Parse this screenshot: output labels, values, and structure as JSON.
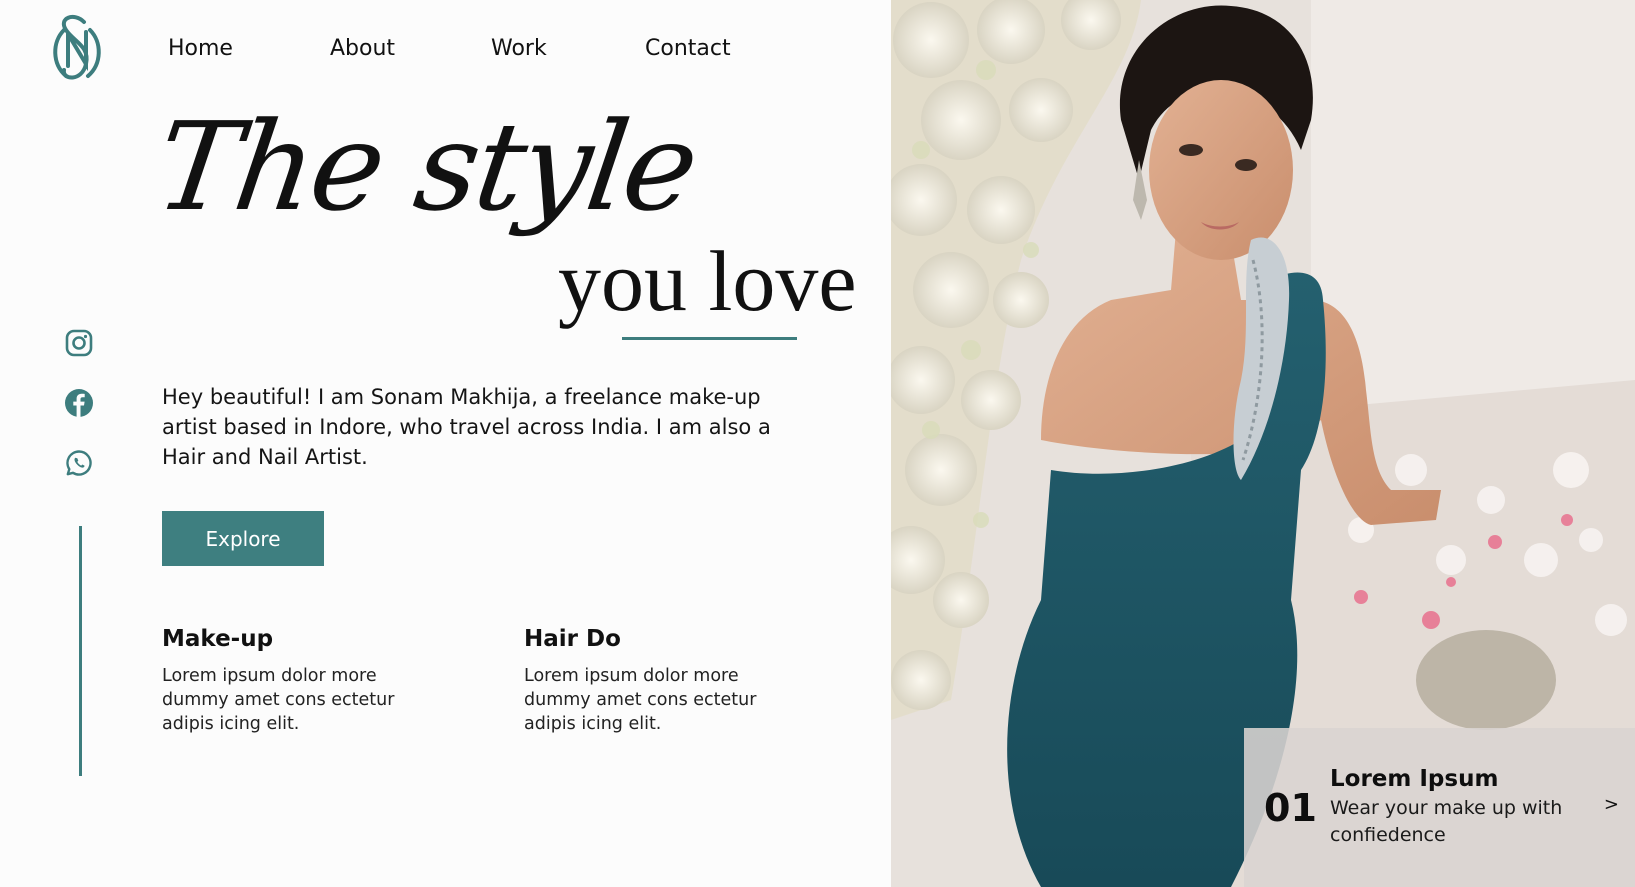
{
  "brand": {
    "logo_letters": "SM"
  },
  "nav": {
    "items": [
      "Home",
      "About",
      "Work",
      "Contact"
    ]
  },
  "hero": {
    "script_line": "The style",
    "serif_line": "you love",
    "intro": "Hey beautiful! I am Sonam Makhija, a freelance make-up artist based in Indore, who travel across India. I am also a Hair and Nail Artist.",
    "cta_label": "Explore"
  },
  "social": {
    "icons": [
      "instagram-icon",
      "facebook-icon",
      "whatsapp-icon"
    ]
  },
  "services": [
    {
      "title": "Make-up",
      "text": "Lorem ipsum dolor more dummy amet cons ectetur adipis icing elit."
    },
    {
      "title": "Hair Do",
      "text": "Lorem ipsum dolor more dummy amet cons ectetur adipis icing elit."
    }
  ],
  "card": {
    "number": "01",
    "title": "Lorem Ipsum",
    "text": "Wear your make up with confiedence",
    "next": ">"
  },
  "colors": {
    "accent": "#3e7f80",
    "dress": "#1f5566"
  }
}
